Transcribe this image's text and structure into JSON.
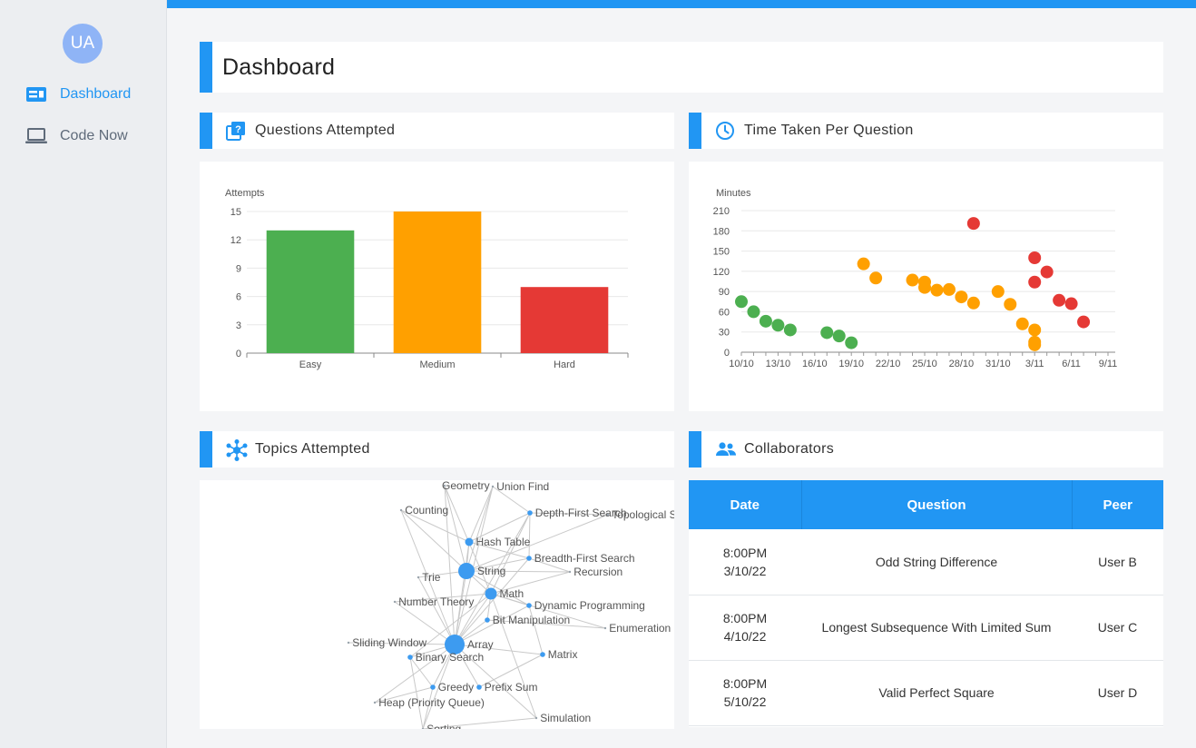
{
  "sidebar": {
    "avatar_initials": "UA",
    "items": [
      {
        "label": "Dashboard",
        "icon": "dashboard-icon",
        "active": true
      },
      {
        "label": "Code Now",
        "icon": "laptop-icon",
        "active": false
      }
    ]
  },
  "colors": {
    "accent": "#2196f3",
    "easy": "#4caf50",
    "medium": "#ffa000",
    "hard": "#e53935"
  },
  "header": {
    "title": "Dashboard"
  },
  "sections": {
    "questions_attempted": "Questions Attempted",
    "time_taken": "Time Taken Per Question",
    "topics_attempted": "Topics Attempted",
    "collaborators": "Collaborators"
  },
  "chart_data": [
    {
      "type": "bar",
      "title": "",
      "ylabel": "Attempts",
      "categories": [
        "Easy",
        "Medium",
        "Hard"
      ],
      "values": [
        13,
        15,
        7
      ],
      "ylim": [
        0,
        15
      ],
      "yticks": [
        0,
        3,
        6,
        9,
        12,
        15
      ],
      "colors": [
        "#4caf50",
        "#ffa000",
        "#e53935"
      ],
      "grid": true
    },
    {
      "type": "scatter",
      "title": "",
      "ylabel": "Minutes",
      "xtick_labels": [
        "10/10",
        "13/10",
        "16/10",
        "19/10",
        "22/10",
        "25/10",
        "28/10",
        "31/10",
        "3/11",
        "6/11",
        "9/11"
      ],
      "yticks": [
        0,
        30,
        60,
        90,
        120,
        150,
        180,
        210
      ],
      "ylim": [
        0,
        210
      ],
      "grid": true,
      "points": [
        {
          "x": "2022-10-10",
          "y": 75,
          "color": "#4caf50"
        },
        {
          "x": "2022-10-11",
          "y": 60,
          "color": "#4caf50"
        },
        {
          "x": "2022-10-12",
          "y": 46,
          "color": "#4caf50"
        },
        {
          "x": "2022-10-13",
          "y": 40,
          "color": "#4caf50"
        },
        {
          "x": "2022-10-14",
          "y": 33,
          "color": "#4caf50"
        },
        {
          "x": "2022-10-17",
          "y": 29,
          "color": "#4caf50"
        },
        {
          "x": "2022-10-18",
          "y": 24,
          "color": "#4caf50"
        },
        {
          "x": "2022-10-19",
          "y": 14,
          "color": "#4caf50"
        },
        {
          "x": "2022-10-20",
          "y": 131,
          "color": "#ffa000"
        },
        {
          "x": "2022-10-21",
          "y": 110,
          "color": "#ffa000"
        },
        {
          "x": "2022-10-24",
          "y": 107,
          "color": "#ffa000"
        },
        {
          "x": "2022-10-25",
          "y": 104,
          "color": "#ffa000"
        },
        {
          "x": "2022-10-25",
          "y": 96,
          "color": "#ffa000"
        },
        {
          "x": "2022-10-26",
          "y": 92,
          "color": "#ffa000"
        },
        {
          "x": "2022-10-27",
          "y": 93,
          "color": "#ffa000"
        },
        {
          "x": "2022-10-28",
          "y": 82,
          "color": "#ffa000"
        },
        {
          "x": "2022-10-29",
          "y": 73,
          "color": "#ffa000"
        },
        {
          "x": "2022-10-29",
          "y": 191,
          "color": "#e53935"
        },
        {
          "x": "2022-10-31",
          "y": 90,
          "color": "#ffa000"
        },
        {
          "x": "2022-11-01",
          "y": 71,
          "color": "#ffa000"
        },
        {
          "x": "2022-11-02",
          "y": 42,
          "color": "#ffa000"
        },
        {
          "x": "2022-11-03",
          "y": 33,
          "color": "#ffa000"
        },
        {
          "x": "2022-11-03",
          "y": 15,
          "color": "#ffa000"
        },
        {
          "x": "2022-11-03",
          "y": 11,
          "color": "#ffa000"
        },
        {
          "x": "2022-11-03",
          "y": 140,
          "color": "#e53935"
        },
        {
          "x": "2022-11-03",
          "y": 104,
          "color": "#e53935"
        },
        {
          "x": "2022-11-04",
          "y": 119,
          "color": "#e53935"
        },
        {
          "x": "2022-11-05",
          "y": 77,
          "color": "#e53935"
        },
        {
          "x": "2022-11-06",
          "y": 72,
          "color": "#e53935"
        },
        {
          "x": "2022-11-07",
          "y": 45,
          "color": "#e53935"
        }
      ]
    }
  ],
  "topics_graph": {
    "nodes": [
      {
        "id": "Geometry",
        "label": "Geometry",
        "hub": false,
        "weight": 1
      },
      {
        "id": "UnionFind",
        "label": "Union Find",
        "hub": false,
        "weight": 1
      },
      {
        "id": "Counting",
        "label": "Counting",
        "hub": false,
        "weight": 1
      },
      {
        "id": "DFS",
        "label": "Depth-First Search",
        "hub": true,
        "weight": 2
      },
      {
        "id": "TopoSort",
        "label": "Topological Sort",
        "hub": false,
        "weight": 1
      },
      {
        "id": "HashTable",
        "label": "Hash Table",
        "hub": true,
        "weight": 3
      },
      {
        "id": "BFS",
        "label": "Breadth-First Search",
        "hub": true,
        "weight": 2
      },
      {
        "id": "Recursion",
        "label": "Recursion",
        "hub": false,
        "weight": 1
      },
      {
        "id": "Trie",
        "label": "Trie",
        "hub": false,
        "weight": 1
      },
      {
        "id": "String",
        "label": "String",
        "hub": true,
        "weight": 5
      },
      {
        "id": "Math",
        "label": "Math",
        "hub": true,
        "weight": 4
      },
      {
        "id": "NumberTheory",
        "label": "Number Theory",
        "hub": false,
        "weight": 1
      },
      {
        "id": "DP",
        "label": "Dynamic Programming",
        "hub": true,
        "weight": 2
      },
      {
        "id": "BitManip",
        "label": "Bit Manipulation",
        "hub": true,
        "weight": 2
      },
      {
        "id": "Enumeration",
        "label": "Enumeration",
        "hub": false,
        "weight": 1
      },
      {
        "id": "SlidingWindow",
        "label": "Sliding Window",
        "hub": false,
        "weight": 1
      },
      {
        "id": "Array",
        "label": "Array",
        "hub": true,
        "weight": 6
      },
      {
        "id": "BinarySearch",
        "label": "Binary Search",
        "hub": true,
        "weight": 2
      },
      {
        "id": "Matrix",
        "label": "Matrix",
        "hub": true,
        "weight": 2
      },
      {
        "id": "Greedy",
        "label": "Greedy",
        "hub": true,
        "weight": 2
      },
      {
        "id": "PrefixSum",
        "label": "Prefix Sum",
        "hub": true,
        "weight": 2
      },
      {
        "id": "Heap",
        "label": "Heap (Priority Queue)",
        "hub": false,
        "weight": 1
      },
      {
        "id": "Simulation",
        "label": "Simulation",
        "hub": false,
        "weight": 1
      },
      {
        "id": "Sorting",
        "label": "Sorting",
        "hub": false,
        "weight": 1
      }
    ],
    "edges": [
      [
        "Array",
        "HashTable"
      ],
      [
        "Array",
        "String"
      ],
      [
        "Array",
        "Math"
      ],
      [
        "Array",
        "BinarySearch"
      ],
      [
        "Array",
        "Greedy"
      ],
      [
        "Array",
        "PrefixSum"
      ],
      [
        "Array",
        "Matrix"
      ],
      [
        "Array",
        "SlidingWindow"
      ],
      [
        "Array",
        "Heap"
      ],
      [
        "Array",
        "Simulation"
      ],
      [
        "Array",
        "Sorting"
      ],
      [
        "Array",
        "DP"
      ],
      [
        "Array",
        "BitManip"
      ],
      [
        "Array",
        "NumberTheory"
      ],
      [
        "Array",
        "Counting"
      ],
      [
        "Array",
        "DFS"
      ],
      [
        "Array",
        "BFS"
      ],
      [
        "Array",
        "Trie"
      ],
      [
        "Array",
        "Geometry"
      ],
      [
        "Array",
        "UnionFind"
      ],
      [
        "String",
        "HashTable"
      ],
      [
        "String",
        "Math"
      ],
      [
        "String",
        "Trie"
      ],
      [
        "String",
        "Counting"
      ],
      [
        "String",
        "DP"
      ],
      [
        "String",
        "Geometry"
      ],
      [
        "String",
        "UnionFind"
      ],
      [
        "String",
        "Recursion"
      ],
      [
        "String",
        "BFS"
      ],
      [
        "String",
        "TopoSort"
      ],
      [
        "Math",
        "NumberTheory"
      ],
      [
        "Math",
        "BitManip"
      ],
      [
        "Math",
        "DP"
      ],
      [
        "Math",
        "Enumeration"
      ],
      [
        "Math",
        "Recursion"
      ],
      [
        "Math",
        "Geometry"
      ],
      [
        "Math",
        "DFS"
      ],
      [
        "Math",
        "BinarySearch"
      ],
      [
        "Math",
        "Simulation"
      ],
      [
        "HashTable",
        "Counting"
      ],
      [
        "HashTable",
        "DFS"
      ],
      [
        "HashTable",
        "UnionFind"
      ],
      [
        "HashTable",
        "BFS"
      ],
      [
        "DFS",
        "TopoSort"
      ],
      [
        "DFS",
        "BFS"
      ],
      [
        "DFS",
        "UnionFind"
      ],
      [
        "BFS",
        "Recursion"
      ],
      [
        "BitManip",
        "Enumeration"
      ],
      [
        "BinarySearch",
        "Sorting"
      ],
      [
        "Greedy",
        "Sorting"
      ],
      [
        "Greedy",
        "Heap"
      ],
      [
        "PrefixSum",
        "Matrix"
      ],
      [
        "Sorting",
        "Simulation"
      ],
      [
        "Matrix",
        "DP"
      ],
      [
        "BinarySearch",
        "Greedy"
      ]
    ]
  },
  "collaborators": {
    "columns": [
      "Date",
      "Question",
      "Peer"
    ],
    "rows": [
      {
        "time": "8:00PM",
        "date": "3/10/22",
        "question": "Odd String Difference",
        "peer": "User B"
      },
      {
        "time": "8:00PM",
        "date": "4/10/22",
        "question": "Longest Subsequence With Limited Sum",
        "peer": "User C"
      },
      {
        "time": "8:00PM",
        "date": "5/10/22",
        "question": "Valid Perfect Square",
        "peer": "User D"
      }
    ]
  }
}
